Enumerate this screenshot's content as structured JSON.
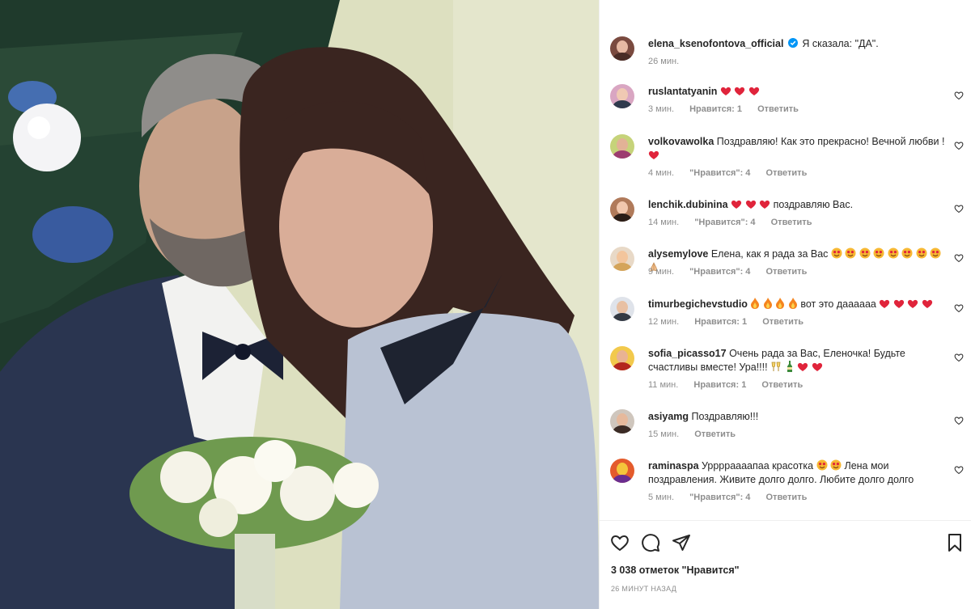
{
  "post": {
    "author": "elena_ksenofontova_official",
    "caption": "Я сказала: \"ДА\".",
    "time": "26 мин.",
    "likes": "3 038 отметок \"Нравится\"",
    "posted": "26 МИНУТ НАЗАД"
  },
  "comments": [
    {
      "user": "ruslantatyanin",
      "text": "",
      "emoji": [
        "heart",
        "heart",
        "heart"
      ],
      "time": "3 мин.",
      "likes": "Нравится: 1",
      "reply": "Ответить"
    },
    {
      "user": "volkovawolka",
      "text": "Поздравляю! Как это прекрасно! Вечной любви !",
      "emoji": [
        "heart"
      ],
      "time": "4 мин.",
      "likes": "\"Нравится\": 4",
      "reply": "Ответить"
    },
    {
      "user": "lenchik.dubinina",
      "text": "поздравляю Вас.",
      "emoji_before": [
        "heart",
        "heart",
        "heart"
      ],
      "time": "14 мин.",
      "likes": "\"Нравится\": 4",
      "reply": "Ответить"
    },
    {
      "user": "alysemylove",
      "text": "Елена, как я рада за Вас",
      "emoji": [
        "star",
        "star",
        "star",
        "star",
        "star",
        "star",
        "star",
        "star",
        "pray"
      ],
      "time": "9 мин.",
      "likes": "\"Нравится\": 4",
      "reply": "Ответить"
    },
    {
      "user": "timurbegichevstudio",
      "text": "вот это даааааа",
      "emoji_before": [
        "fire",
        "fire",
        "fire",
        "fire"
      ],
      "emoji": [
        "heart",
        "heart",
        "heart",
        "heart"
      ],
      "time": "12 мин.",
      "likes": "Нравится: 1",
      "reply": "Ответить"
    },
    {
      "user": "sofia_picasso17",
      "text": "Очень рада за Вас, Еленочка! Будьте счастливы вместе! Ура!!!!",
      "emoji": [
        "toast",
        "bottle",
        "heart",
        "heart"
      ],
      "time": "11 мин.",
      "likes": "Нравится: 1",
      "reply": "Ответить"
    },
    {
      "user": "asiyamg",
      "text": "Поздравляю!!!",
      "time": "15 мин.",
      "likes": "",
      "reply": "Ответить"
    },
    {
      "user": "raminaspa",
      "text": "Урррраааапаа красотка",
      "text2": "Лена мои поздравления. Живите долго долго. Любите долго долго",
      "emoji": [
        "star",
        "star"
      ],
      "time": "5 мин.",
      "likes": "\"Нравится\": 4",
      "reply": "Ответить"
    }
  ],
  "icons": {
    "like": "heart-icon",
    "comment": "comment-icon",
    "share": "share-icon",
    "save": "bookmark-icon"
  },
  "colors": {
    "heart": "#ed4956",
    "verified": "#0095f6",
    "meta": "#8e8e8e"
  }
}
